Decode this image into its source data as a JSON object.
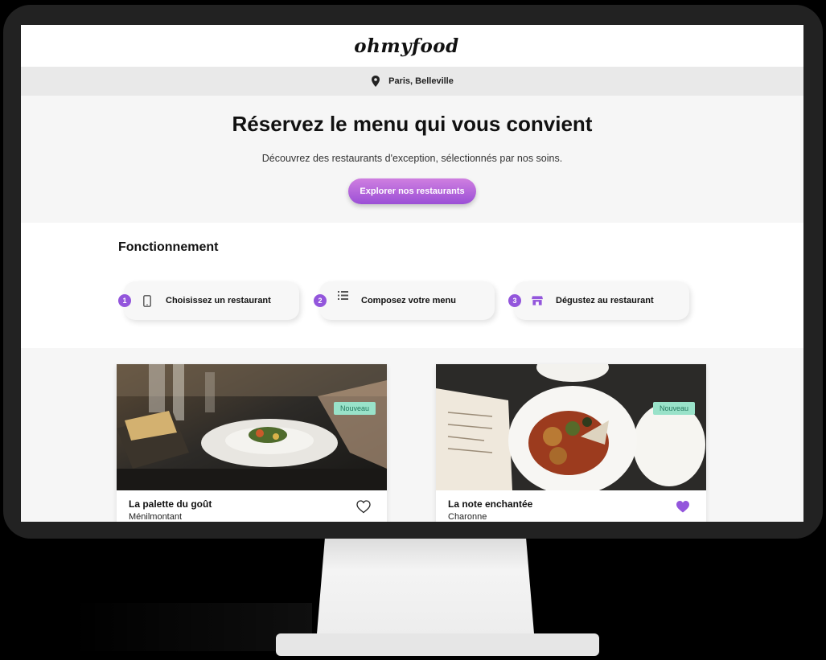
{
  "brand": {
    "logo": "ohmyfood"
  },
  "location": {
    "text": "Paris, Belleville",
    "icon": "map-pin-icon"
  },
  "hero": {
    "title": "Réservez le menu qui vous convient",
    "subtitle": "Découvrez des restaurants d'exception, sélectionnés par nos soins.",
    "cta_label": "Explorer nos restaurants"
  },
  "how": {
    "title": "Fonctionnement",
    "steps": [
      {
        "num": "1",
        "label": "Choisissez un restaurant",
        "icon": "smartphone-icon"
      },
      {
        "num": "2",
        "label": "Composez votre menu",
        "icon": "list-icon"
      },
      {
        "num": "3",
        "label": "Dégustez au restaurant",
        "icon": "store-icon"
      }
    ]
  },
  "restaurants": [
    {
      "name": "La palette du goût",
      "area": "Ménilmontant",
      "badge": "Nouveau",
      "liked": false
    },
    {
      "name": "La note enchantée",
      "area": "Charonne",
      "badge": "Nouveau",
      "liked": true
    }
  ],
  "colors": {
    "accent": "#9356dc",
    "badge_bg": "#99e2c9",
    "badge_text": "#257a5f"
  }
}
